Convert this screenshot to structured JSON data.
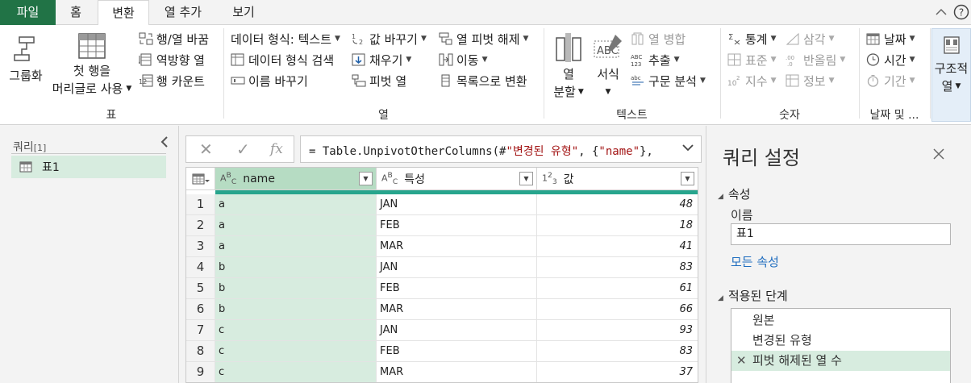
{
  "tabs": [
    "파일",
    "홈",
    "변환",
    "열 추가",
    "보기"
  ],
  "window_controls": {
    "collapse": "^",
    "help": "?"
  },
  "ribbon": {
    "table_group": {
      "label": "표",
      "group_by": "그룹화",
      "first_row_header_line1": "첫 행을",
      "first_row_header_line2": "머리글로 사용",
      "transpose": "행/열 바꿈",
      "reverse_rows": "역방향 열",
      "count_rows": "행 카운트"
    },
    "column_group": {
      "label": "열",
      "data_type": "데이터 형식: 텍스트",
      "detect_type": "데이터 형식 검색",
      "rename": "이름 바꾸기",
      "replace_values": "값 바꾸기",
      "fill": "채우기",
      "pivot": "피벗 열",
      "unpivot": "열 피벗 해제",
      "move": "이동",
      "to_list": "목록으로 변환"
    },
    "text_group": {
      "label": "텍스트",
      "split_line1": "열",
      "split_line2": "분할",
      "format": "서식",
      "merge": "열 병합",
      "extract": "추출",
      "parse": "구문 분석"
    },
    "number_group": {
      "label": "숫자",
      "statistics": "통계",
      "standard": "표준",
      "scientific": "지수",
      "trig": "삼각",
      "rounding": "반올림",
      "info": "정보"
    },
    "datetime_group": {
      "label": "날짜 및 ...",
      "date": "날짜",
      "time": "시간",
      "duration": "기간"
    },
    "structured_group": {
      "line1": "구조적",
      "line2": "열"
    }
  },
  "queries": {
    "title": "쿼리",
    "count": "[1]",
    "items": [
      "표1"
    ]
  },
  "formula": {
    "cancel": "✕",
    "confirm": "✓",
    "fx": "fx",
    "prefix": "= Table.UnpivotOtherColumns(#",
    "str1": "\"변경된 유형\"",
    "mid": ", {",
    "str2": "\"name\"",
    "suffix": "},"
  },
  "grid": {
    "columns": [
      {
        "type": "ABC",
        "name": "name"
      },
      {
        "type": "ABC",
        "name": "특성"
      },
      {
        "type": "123",
        "name": "값"
      }
    ],
    "rows": [
      [
        "1",
        "a",
        "JAN",
        "48"
      ],
      [
        "2",
        "a",
        "FEB",
        "18"
      ],
      [
        "3",
        "a",
        "MAR",
        "41"
      ],
      [
        "4",
        "b",
        "JAN",
        "83"
      ],
      [
        "5",
        "b",
        "FEB",
        "61"
      ],
      [
        "6",
        "b",
        "MAR",
        "66"
      ],
      [
        "7",
        "c",
        "JAN",
        "93"
      ],
      [
        "8",
        "c",
        "FEB",
        "83"
      ],
      [
        "9",
        "c",
        "MAR",
        "37"
      ]
    ]
  },
  "settings": {
    "title": "쿼리 설정",
    "properties_label": "속성",
    "name_label": "이름",
    "name_value": "표1",
    "all_properties": "모든 속성",
    "applied_steps_label": "적용된 단계",
    "steps": [
      "원본",
      "변경된 유형",
      "피벗 해제된 열 수"
    ]
  },
  "colors": {
    "accent": "#217346",
    "selection": "#d7ecdf",
    "quality_bar": "#27a58d",
    "link": "#1f6dbf"
  }
}
